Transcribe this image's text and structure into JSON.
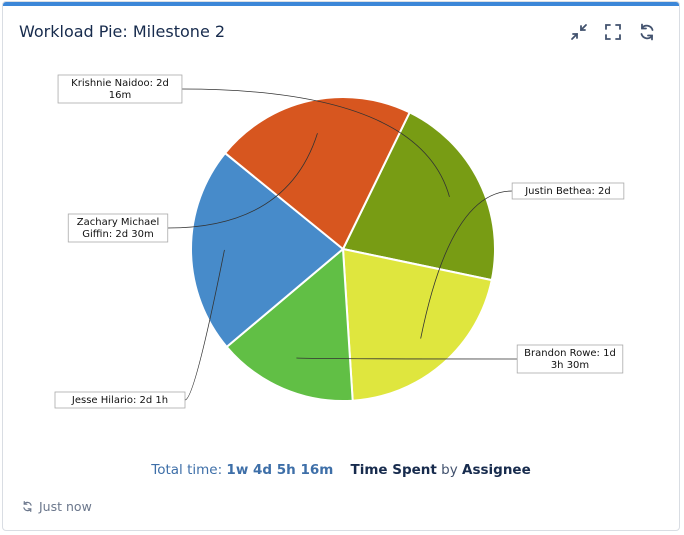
{
  "widget": {
    "title": "Workload Pie: Milestone 2",
    "icons": [
      "collapse-icon",
      "fullscreen-icon",
      "refresh-icon"
    ],
    "accent_color": "#3c87d8"
  },
  "chart_data": {
    "type": "pie",
    "title": "",
    "series": [
      {
        "name": "Krishnie Naidoo",
        "label": "Krishnie Naidoo: 2d 16m",
        "hours": 16.27,
        "color": "#789c14"
      },
      {
        "name": "Justin Bethea",
        "label": "Justin Bethea: 2d",
        "hours": 16.0,
        "color": "#dfe63e"
      },
      {
        "name": "Brandon Rowe",
        "label": "Brandon Rowe: 1d 3h 30m",
        "hours": 11.5,
        "color": "#61bf45"
      },
      {
        "name": "Jesse Hilario",
        "label": "Jesse Hilario: 2d 1h",
        "hours": 17.0,
        "color": "#478bca"
      },
      {
        "name": "Zachary Michael Giffin",
        "label": "Zachary Michael Giffin: 2d 30m",
        "hours": 16.5,
        "color": "#d7561f"
      }
    ]
  },
  "footer": {
    "total_label": "Total time:",
    "total_value": "1w 4d 5h 16m",
    "metric": "Time Spent",
    "by": "by",
    "group": "Assignee",
    "refresh_text": "Just now"
  }
}
